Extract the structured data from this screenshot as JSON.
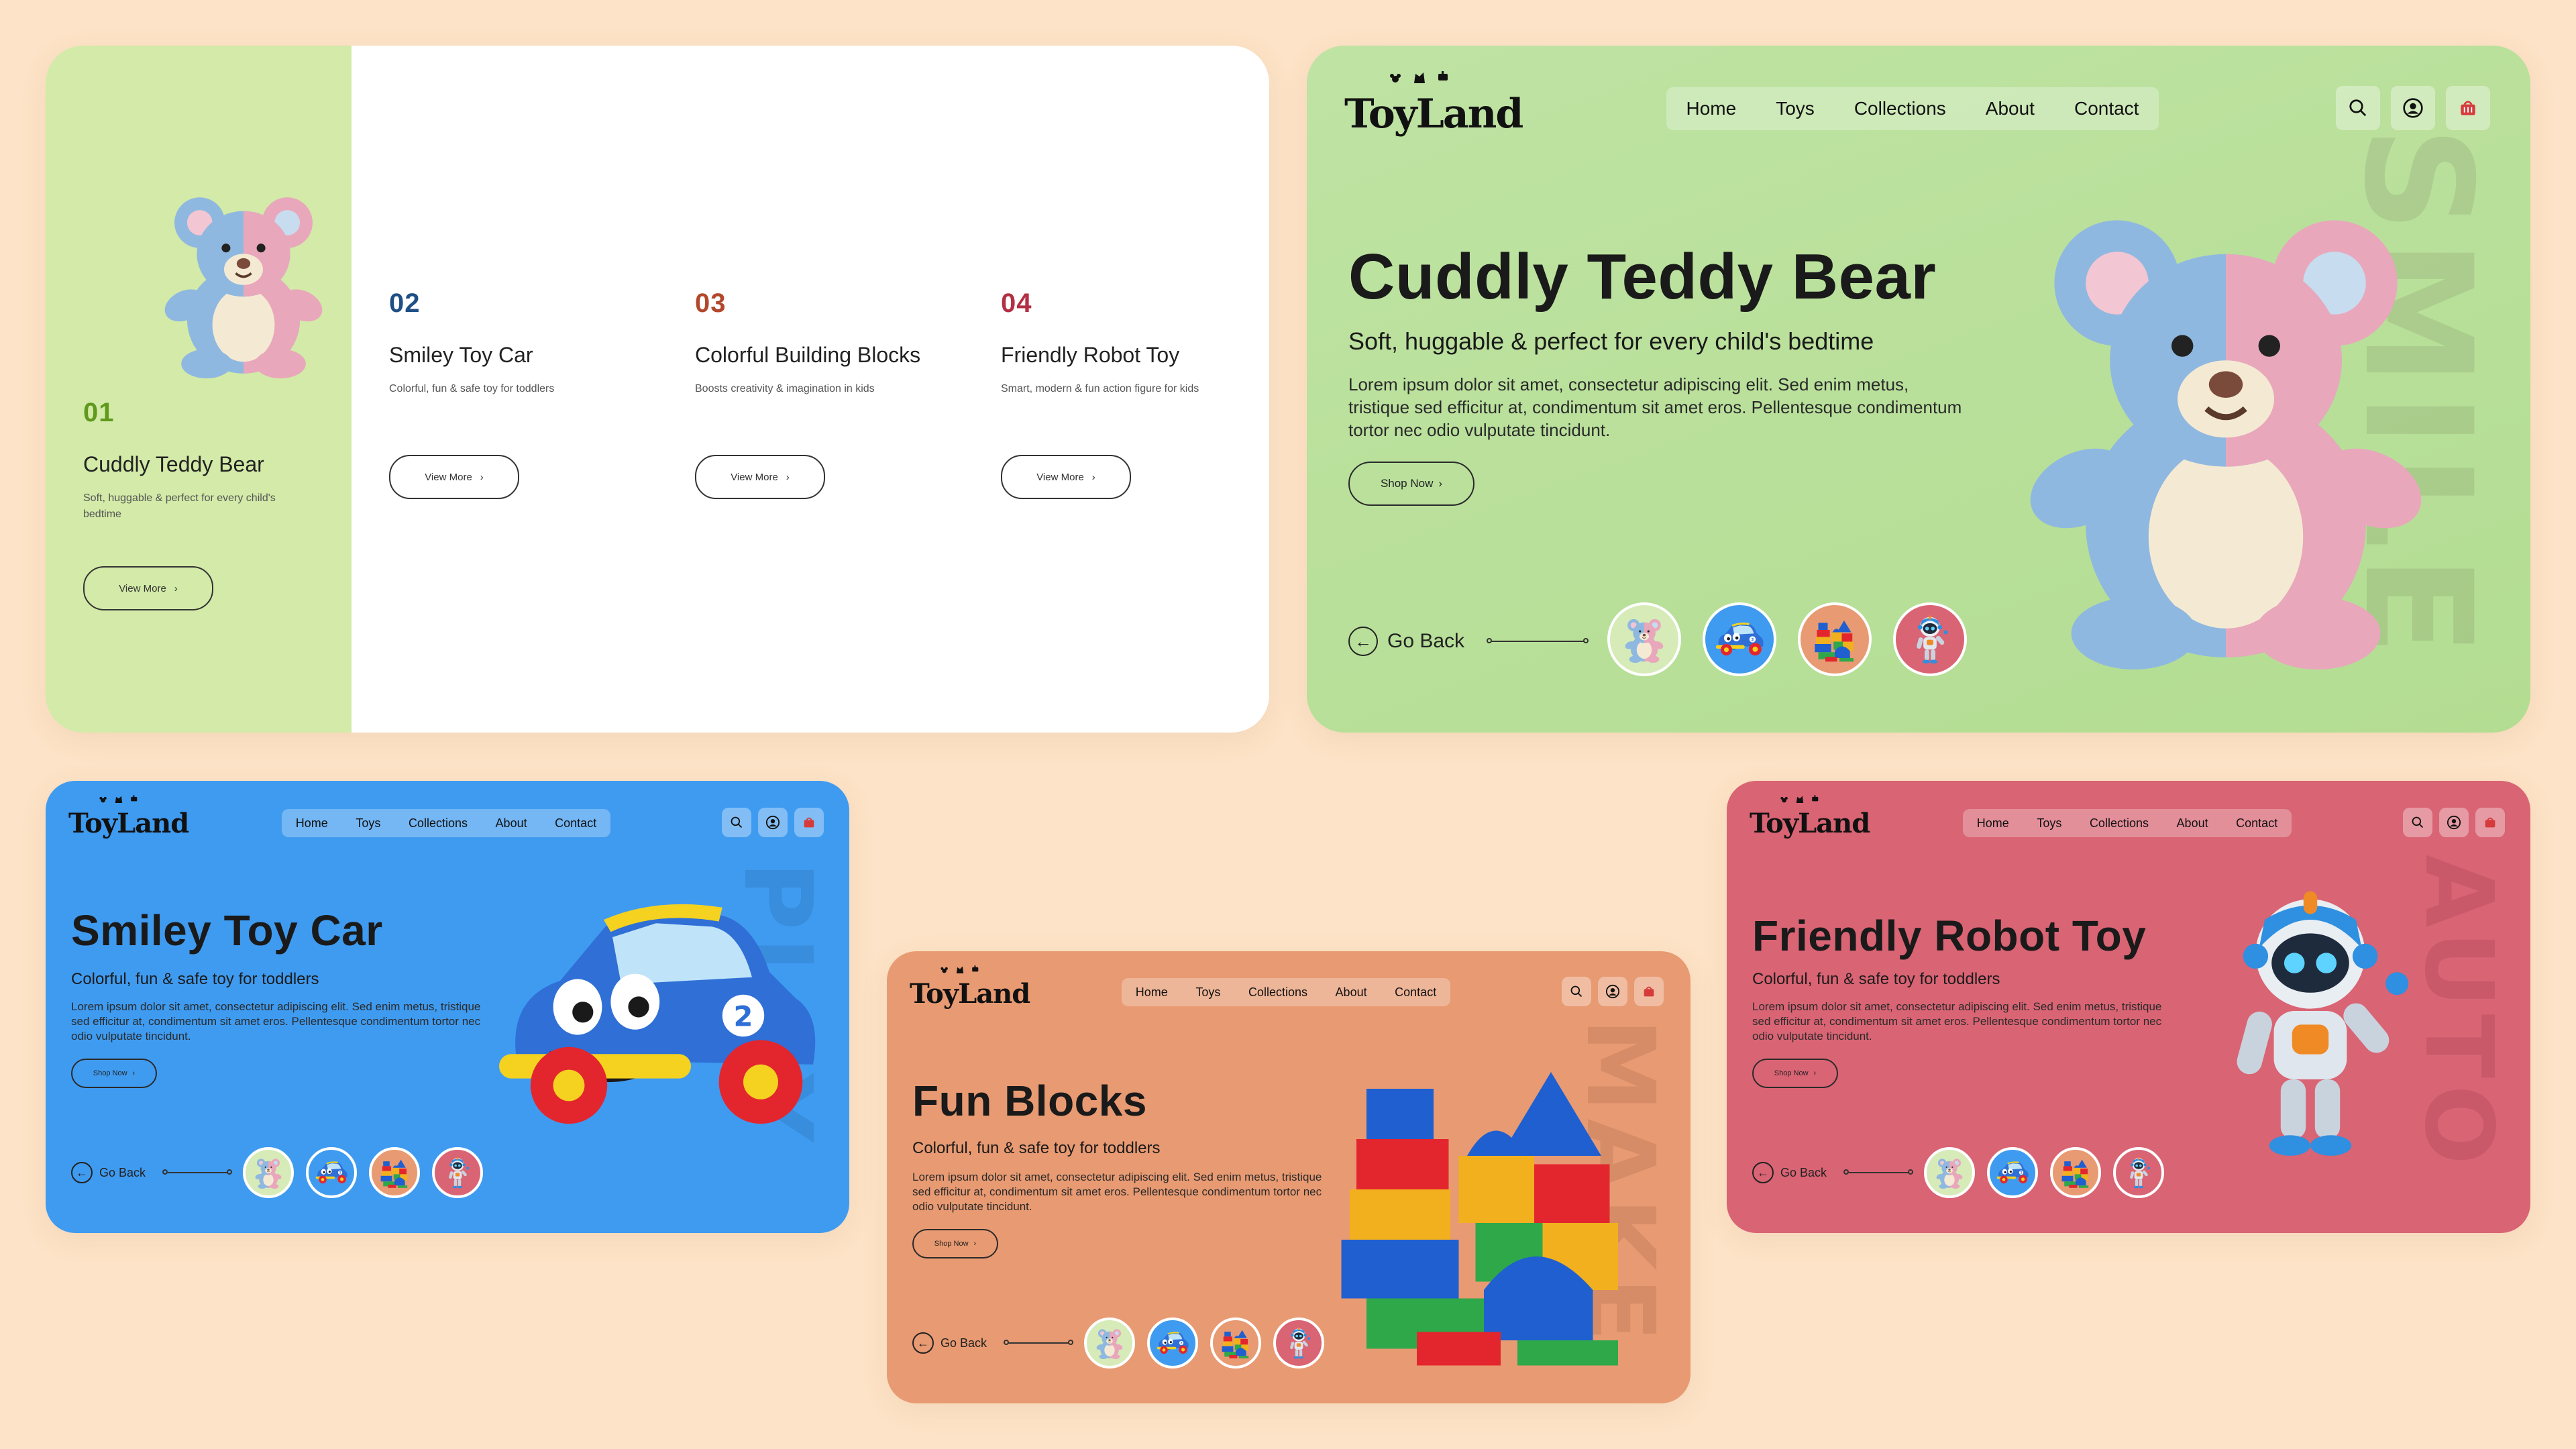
{
  "brand": {
    "logo": "ToyLand"
  },
  "nav": [
    "Home",
    "Toys",
    "Collections",
    "About",
    "Contact"
  ],
  "icons": [
    "search-icon",
    "user-icon",
    "basket-icon"
  ],
  "colors": {
    "background": "#fde3c7",
    "green": "#b7e099",
    "blue": "#3f9bf0",
    "orange": "#e89a72",
    "pink": "#d96474",
    "num_green": "#5f9a1f",
    "num_blue": "#1f4f86",
    "num_orange": "#b2472a",
    "num_red": "#b22f44"
  },
  "list_card": {
    "items": [
      {
        "num": "01",
        "name": "Cuddly Teddy Bear",
        "desc": "Soft, huggable & perfect for every child's bedtime",
        "button": "View More"
      },
      {
        "num": "02",
        "name": "Smiley Toy Car",
        "desc": "Colorful, fun & safe toy for toddlers",
        "button": "View More"
      },
      {
        "num": "03",
        "name": "Colorful Building Blocks",
        "desc": "Boosts creativity & imagination in kids",
        "button": "View More"
      },
      {
        "num": "04",
        "name": "Friendly Robot Toy",
        "desc": "Smart, modern & fun action figure for kids",
        "button": "View More"
      }
    ]
  },
  "heroes": {
    "teddy": {
      "title": "Cuddly Teddy Bear",
      "subtitle": "Soft, huggable & perfect for every child's bedtime",
      "body": "Lorem ipsum dolor sit amet, consectetur adipiscing elit. Sed enim metus, tristique sed efficitur at, condimentum sit amet eros. Pellentesque condimentum tortor nec odio vulputate tincidunt.",
      "button": "Shop Now",
      "go_back": "Go Back",
      "watermark": "SMILE"
    },
    "car": {
      "title": "Smiley Toy Car",
      "subtitle": "Colorful, fun & safe toy for toddlers",
      "body": "Lorem ipsum dolor sit amet, consectetur adipiscing elit. Sed enim metus, tristique sed efficitur at, condimentum sit amet eros. Pellentesque condimentum tortor nec odio vulputate tincidunt.",
      "button": "Shop Now",
      "go_back": "Go Back",
      "watermark": "PLAY"
    },
    "blocks": {
      "title": "Fun Blocks",
      "subtitle": "Colorful, fun & safe toy for toddlers",
      "body": "Lorem ipsum dolor sit amet, consectetur adipiscing elit. Sed enim metus, tristique sed efficitur at, condimentum sit amet eros. Pellentesque condimentum tortor nec odio vulputate tincidunt.",
      "button": "Shop Now",
      "go_back": "Go Back",
      "watermark": "MAKE"
    },
    "robot": {
      "title": "Friendly Robot Toy",
      "subtitle": "Colorful, fun & safe toy for toddlers",
      "body": "Lorem ipsum dolor sit amet, consectetur adipiscing elit. Sed enim metus, tristique sed efficitur at, condimentum sit amet eros. Pellentesque condimentum tortor nec odio vulputate tincidunt.",
      "button": "Shop Now",
      "go_back": "Go Back",
      "watermark": "AUTO"
    }
  }
}
